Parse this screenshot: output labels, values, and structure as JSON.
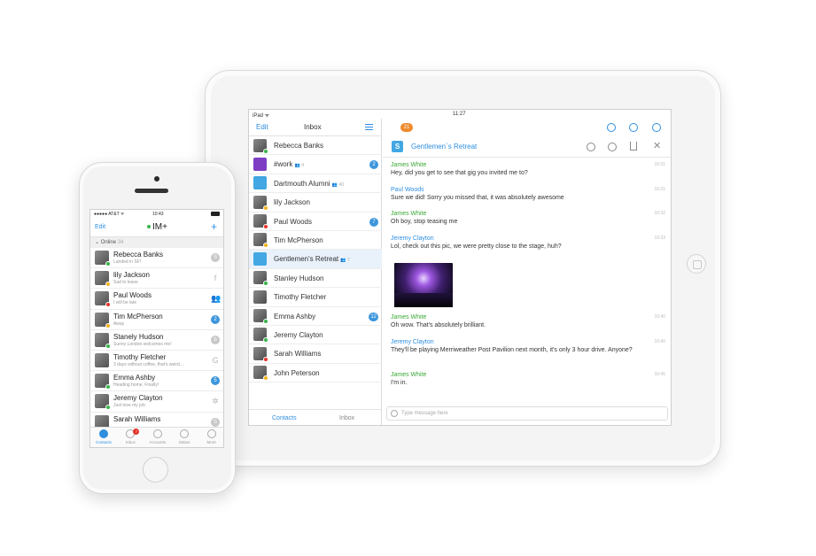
{
  "ipad": {
    "status": {
      "carrier": "iPad ᯤ",
      "time": "11:27"
    },
    "inbox": {
      "edit_label": "Edit",
      "title": "Inbox",
      "items": [
        {
          "name": "Rebecca Banks",
          "sub": "",
          "badge": "",
          "presence": "g",
          "avatar": "photo"
        },
        {
          "name": "#work",
          "sub": "👥 4",
          "badge": "2",
          "presence": "",
          "avatar": "yahoo"
        },
        {
          "name": "Dartmouth Alumni",
          "sub": "👥 40",
          "badge": "",
          "presence": "",
          "avatar": "skype"
        },
        {
          "name": "lily Jackson",
          "sub": "",
          "badge": "",
          "presence": "y",
          "avatar": "photo"
        },
        {
          "name": "Paul Woods",
          "sub": "",
          "badge": "7",
          "presence": "r",
          "avatar": "photo"
        },
        {
          "name": "Tim McPherson",
          "sub": "",
          "badge": "",
          "presence": "y",
          "avatar": "photo"
        },
        {
          "name": "Gentlemen's Retreat",
          "sub": "👥 7",
          "badge": "",
          "presence": "",
          "avatar": "skype",
          "selected": true
        },
        {
          "name": "Stanley Hudson",
          "sub": "",
          "badge": "",
          "presence": "g",
          "avatar": "photo"
        },
        {
          "name": "Timothy Fletcher",
          "sub": "",
          "badge": "",
          "presence": "",
          "avatar": "photo"
        },
        {
          "name": "Emma Ashby",
          "sub": "",
          "badge": "12",
          "presence": "g",
          "avatar": "photo"
        },
        {
          "name": "Jeremy Clayton",
          "sub": "",
          "badge": "",
          "presence": "g",
          "avatar": "photo"
        },
        {
          "name": "Sarah Williams",
          "sub": "",
          "badge": "",
          "presence": "r",
          "avatar": "photo"
        },
        {
          "name": "John Peterson",
          "sub": "",
          "badge": "",
          "presence": "y",
          "avatar": "photo"
        }
      ],
      "tab_contacts": "Contacts",
      "tab_inbox": "Inbox"
    },
    "chat": {
      "unread_count": "21",
      "title": "Gentlemen`s Retreat",
      "messages": [
        {
          "who": "James White",
          "color": "green",
          "text": "Hey, did you get to see that gig you invited me to?",
          "time": "10:31"
        },
        {
          "who": "Paul Woods",
          "color": "blue",
          "text": "Sure we did! Sorry you missed that, it was absolutely awesome",
          "time": "10:31"
        },
        {
          "who": "James White",
          "color": "green",
          "text": "Oh boy, stop teasing me",
          "time": "10:32"
        },
        {
          "who": "Jeremy Clayton",
          "color": "blue",
          "text": "Lol, check out this pic, we were pretty close to the stage, huh?",
          "time": "10:33"
        },
        {
          "who": "James White",
          "color": "green",
          "text": "Oh wow. That's absolutely brilliant.",
          "time": "10:40"
        },
        {
          "who": "Jeremy Clayton",
          "color": "blue",
          "text": "They'll be playing Merriweather Post Pavilion next month, it's only 3 hour drive. Anyone?",
          "time": "10:40"
        },
        {
          "who": "James White",
          "color": "green",
          "text": "I'm in.",
          "time": "10:45"
        }
      ],
      "input_placeholder": "Type message here"
    }
  },
  "iphone": {
    "status": {
      "carrier": "●●●●● AT&T ᯤ",
      "time": "10:43"
    },
    "nav": {
      "edit_label": "Edit",
      "title": "IM+",
      "plus": "+"
    },
    "section": {
      "label": "Online",
      "count": "34"
    },
    "contacts": [
      {
        "name": "Rebecca Banks",
        "status": "Landed in SF!",
        "presence": "g",
        "service": "S",
        "kind": "svc"
      },
      {
        "name": "lily Jackson",
        "status": "Sad to leave",
        "presence": "y",
        "service": "f",
        "kind": "plain"
      },
      {
        "name": "Paul Woods",
        "status": "I will be late",
        "presence": "r",
        "service": "👥",
        "kind": "plain"
      },
      {
        "name": "Tim McPherson",
        "status": "Away",
        "presence": "y",
        "service": "2",
        "kind": "badge"
      },
      {
        "name": "Stanely Hudson",
        "status": "Sunny London welcomes me!",
        "presence": "g",
        "service": "b",
        "kind": "svc"
      },
      {
        "name": "Timothy Fletcher",
        "status": "3 days without coffee, that's weird...",
        "presence": "",
        "service": "G",
        "kind": "plain"
      },
      {
        "name": "Emma Ashby",
        "status": "Heading home. Finally!",
        "presence": "g",
        "service": "5",
        "kind": "badge"
      },
      {
        "name": "Jeremy Clayton",
        "status": "Just love my job",
        "presence": "g",
        "service": "✲",
        "kind": "plain"
      },
      {
        "name": "Sarah Williams",
        "status": "",
        "presence": "",
        "service": "S",
        "kind": "svc"
      }
    ],
    "tabs": [
      {
        "label": "Contacts",
        "active": true,
        "badge": ""
      },
      {
        "label": "Inbox",
        "active": false,
        "badge": "7"
      },
      {
        "label": "Accounts",
        "active": false,
        "badge": ""
      },
      {
        "label": "Status",
        "active": false,
        "badge": ""
      },
      {
        "label": "More",
        "active": false,
        "badge": ""
      }
    ]
  },
  "colors": {
    "accent": "#2d8ee0",
    "online": "#39b54a",
    "busy": "#e6332a",
    "away": "#f2b21b",
    "unread": "#f08a2c"
  }
}
